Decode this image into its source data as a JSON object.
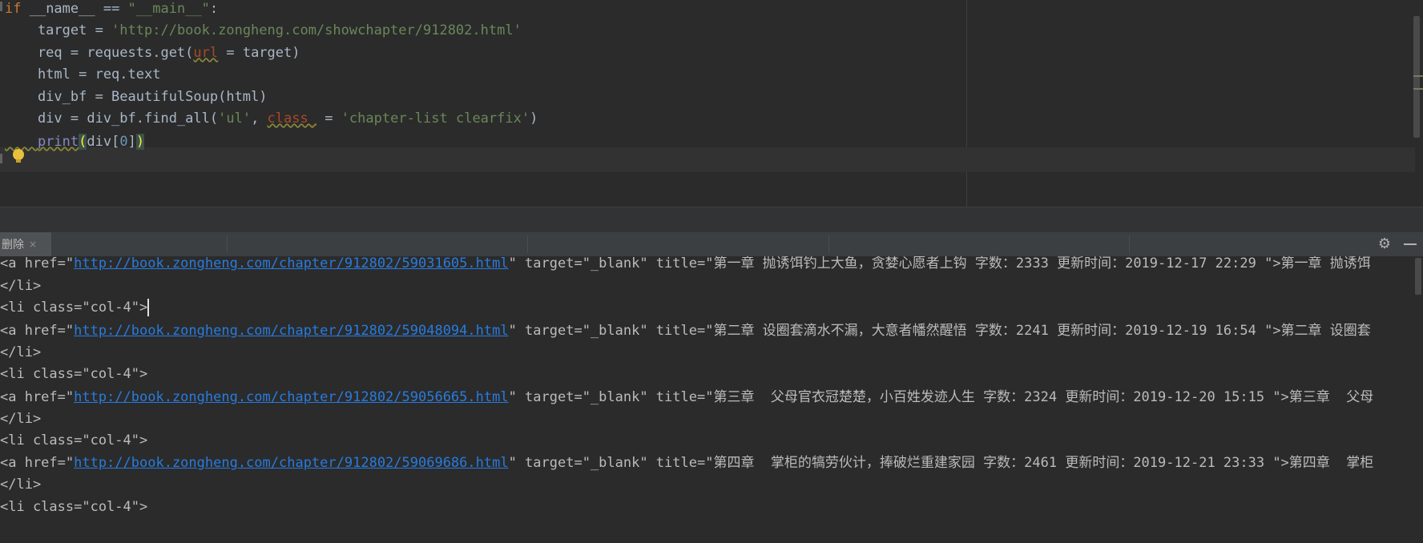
{
  "editor": {
    "lines": [
      {
        "t": "if __name__ == \"__main__\":"
      },
      {
        "t": "    target = 'http://book.zongheng.com/showchapter/912802.html'"
      },
      {
        "t": "    req = requests.get(url = target)"
      },
      {
        "t": "    html = req.text"
      },
      {
        "t": "    div_bf = BeautifulSoup(html)"
      },
      {
        "t": "    div = div_bf.find_all('ul', class_ = 'chapter-list clearfix')"
      },
      {
        "t": "    print(div[0])"
      }
    ],
    "tokens": {
      "l0_if": "if",
      "l0_rest": " __name__ == ",
      "l0_str": "\"__main__\"",
      "l0_colon": ":",
      "l1_a": "    target = ",
      "l1_str": "'http://book.zongheng.com/showchapter/912802.html'",
      "l2_a": "    req = requests.get(",
      "l2_param": "url",
      "l2_b": " = target)",
      "l3": "    html = req.text",
      "l4": "    div_bf = BeautifulSoup(html)",
      "l5_a": "    div = div_bf.find_all(",
      "l5_str1": "'ul'",
      "l5_b": ", ",
      "l5_param": "class_",
      "l5_c": " = ",
      "l5_str2": "'chapter-list clearfix'",
      "l5_d": ")",
      "l6_indent": "    ",
      "l6_print": "print",
      "l6_open": "(",
      "l6_div": "div",
      "l6_idx_open": "[",
      "l6_num": "0",
      "l6_idx_close": "]",
      "l6_close": ")"
    }
  },
  "run_panel": {
    "tab_label": "删除",
    "tab_close": "×",
    "gear_icon": "gear-icon",
    "minimize_icon": "minimize-icon"
  },
  "console": {
    "rows": [
      {
        "prefix": "<a href=\"",
        "link": "http://book.zongheng.com/chapter/912802/59031605.html",
        "suffix": "\" target=\"_blank\" title=\"第一章 抛诱饵钓上大鱼，贪婪心愿者上钩 字数：2333 更新时间：2019-12-17 22:29 \">第一章 抛诱饵"
      },
      {
        "text": "</li>"
      },
      {
        "text": "<li class=\"col-4\">",
        "caret": true
      },
      {
        "prefix": "<a href=\"",
        "link": "http://book.zongheng.com/chapter/912802/59048094.html",
        "suffix": "\" target=\"_blank\" title=\"第二章 设圈套滴水不漏，大意者幡然醒悟 字数：2241 更新时间：2019-12-19 16:54 \">第二章 设圈套"
      },
      {
        "text": "</li>"
      },
      {
        "text": "<li class=\"col-4\">"
      },
      {
        "prefix": "<a href=\"",
        "link": "http://book.zongheng.com/chapter/912802/59056665.html",
        "suffix": "\" target=\"_blank\" title=\"第三章  父母官衣冠楚楚，小百姓发迹人生 字数：2324 更新时间：2019-12-20 15:15 \">第三章  父母"
      },
      {
        "text": "</li>"
      },
      {
        "text": "<li class=\"col-4\">"
      },
      {
        "prefix": "<a href=\"",
        "link": "http://book.zongheng.com/chapter/912802/59069686.html",
        "suffix": "\" target=\"_blank\" title=\"第四章  掌柜的犒劳伙计，捧破烂重建家园 字数：2461 更新时间：2019-12-21 23:33 \">第四章  掌柜"
      },
      {
        "text": "</li>"
      },
      {
        "text": "<li class=\"col-4\">"
      }
    ]
  }
}
